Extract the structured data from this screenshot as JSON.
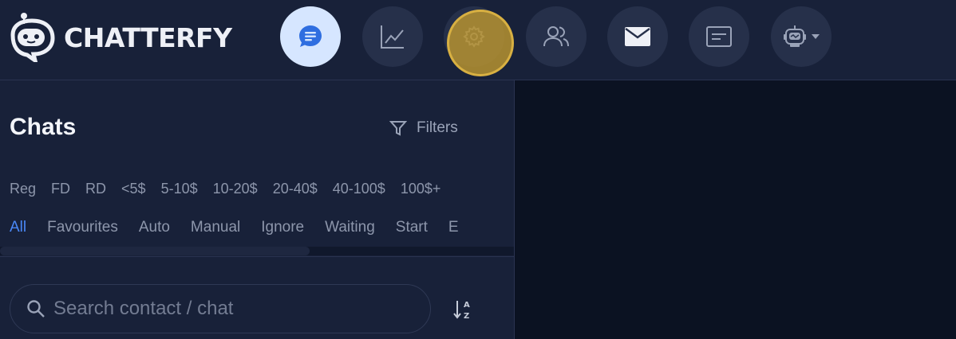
{
  "app": {
    "name": "CHATTERFY"
  },
  "nav": {
    "items": [
      {
        "icon": "chat-bubble-icon",
        "active": true
      },
      {
        "icon": "analytics-chart-icon",
        "active": false
      },
      {
        "icon": "gear-icon",
        "active": false
      },
      {
        "icon": "users-icon",
        "active": false
      },
      {
        "icon": "mail-icon",
        "active": false
      },
      {
        "icon": "message-box-icon",
        "active": false
      },
      {
        "icon": "robot-icon",
        "active": false
      }
    ]
  },
  "colors": {
    "background": "#182139",
    "accent": "#4a88f7",
    "active_nav_bg": "#d6e6ff",
    "right_panel": "#0b1222",
    "highlight": "#d8b042"
  },
  "chats": {
    "title": "Chats",
    "filters_label": "Filters",
    "tags": [
      "Reg",
      "FD",
      "RD",
      "<5$",
      "5-10$",
      "10-20$",
      "20-40$",
      "40-100$",
      "100$+"
    ],
    "tabs": [
      "All",
      "Favourites",
      "Auto",
      "Manual",
      "Ignore",
      "Waiting",
      "Start",
      "E"
    ],
    "active_tab": "All"
  },
  "search": {
    "placeholder": "Search contact / chat",
    "value": ""
  },
  "sort": {
    "icon": "sort-az-icon"
  }
}
